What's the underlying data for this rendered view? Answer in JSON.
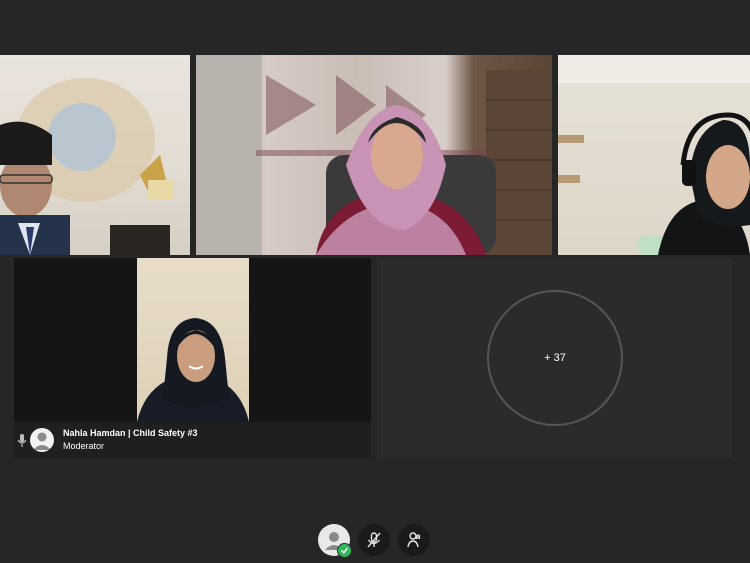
{
  "participants": [
    {
      "id": "tile-1",
      "type": "video",
      "avatar": "man-glasses-suit"
    },
    {
      "id": "tile-2",
      "type": "video",
      "avatar": "woman-pink-hijab"
    },
    {
      "id": "tile-3",
      "type": "video",
      "avatar": "woman-headset"
    }
  ],
  "active_speaker": {
    "name": "Nahla Hamdan | Child Safety #3",
    "role": "Moderator",
    "mic_icon": "mic-icon",
    "avatar_icon": "user-avatar-icon"
  },
  "overflow": {
    "label": "+ 37"
  },
  "controls": [
    {
      "name": "self-avatar-button",
      "icon": "user-icon",
      "status_icon": "check-icon"
    },
    {
      "name": "mute-button",
      "icon": "mic-off-icon"
    },
    {
      "name": "raise-hand-button",
      "icon": "hand-icon"
    }
  ],
  "colors": {
    "background": "#262626",
    "tile": "#2b2b2b",
    "online": "#2fb85b"
  }
}
